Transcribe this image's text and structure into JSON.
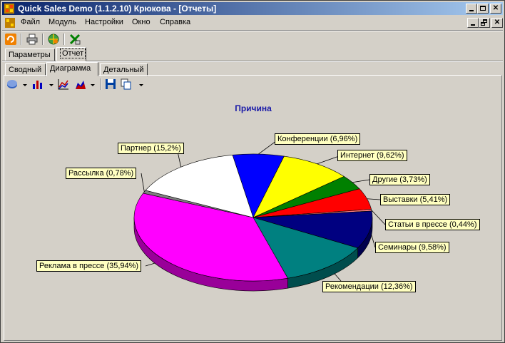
{
  "window": {
    "title": "Quick Sales Demo (1.1.2.10) Крюкова - [Отчеты]"
  },
  "menu": {
    "items": [
      "Файл",
      "Модуль",
      "Настройки",
      "Окно",
      "Справка"
    ]
  },
  "tabs_top": [
    "Параметры",
    "Отчет"
  ],
  "tabs_sub": [
    "Сводный",
    "Диаграмма",
    "Детальный"
  ],
  "colors": {
    "accent": "#0a246a",
    "title_text": "#1a1aa8",
    "label_bg": "#ffffc0"
  },
  "chart_data": {
    "type": "pie",
    "title": "Причина",
    "three_d": true,
    "slices": [
      {
        "label": "Конференции (6,96%)",
        "value": 6.96,
        "color": "#0000ff"
      },
      {
        "label": "Интернет (9,62%)",
        "value": 9.62,
        "color": "#ffff00"
      },
      {
        "label": "Другие (3,73%)",
        "value": 3.73,
        "color": "#008000"
      },
      {
        "label": "Выставки (5,41%)",
        "value": 5.41,
        "color": "#ff0000"
      },
      {
        "label": "Статьи в прессе (0,44%)",
        "value": 0.44,
        "color": "#ff8080"
      },
      {
        "label": "Семинары (9,58%)",
        "value": 9.58,
        "color": "#000080"
      },
      {
        "label": "Рекомендации (12,36%)",
        "value": 12.36,
        "color": "#008080"
      },
      {
        "label": "Реклама в прессе (35,94%)",
        "value": 35.94,
        "color": "#ff00ff"
      },
      {
        "label": "Рассылка (0,78%)",
        "value": 0.78,
        "color": "#808080"
      },
      {
        "label": "Партнер (15,2%)",
        "value": 15.2,
        "color": "#ffffff"
      }
    ]
  }
}
